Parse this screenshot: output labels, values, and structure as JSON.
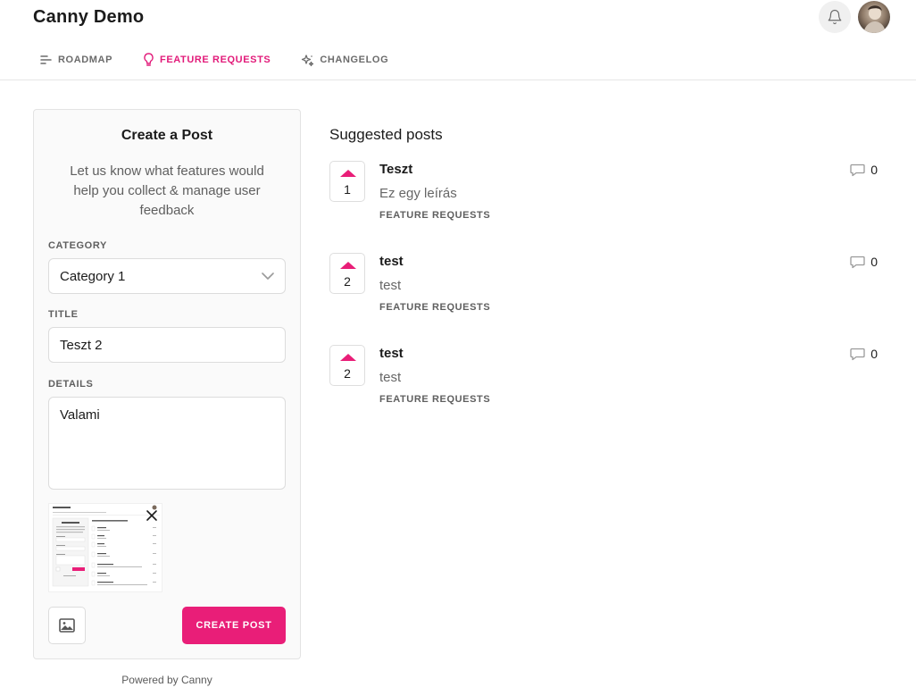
{
  "header": {
    "app_title": "Canny Demo"
  },
  "nav": {
    "items": [
      {
        "label": "ROADMAP",
        "icon": "roadmap-icon",
        "active": false
      },
      {
        "label": "FEATURE REQUESTS",
        "icon": "lightbulb-icon",
        "active": true
      },
      {
        "label": "CHANGELOG",
        "icon": "sparkle-icon",
        "active": false
      }
    ]
  },
  "create_post": {
    "title": "Create a Post",
    "description": "Let us know what features would help you collect & manage user feedback",
    "category": {
      "label": "CATEGORY",
      "value": "Category 1"
    },
    "title_field": {
      "label": "TITLE",
      "value": "Teszt 2"
    },
    "details": {
      "label": "DETAILS",
      "value": "Valami"
    },
    "submit_label": "CREATE POST"
  },
  "powered_by": "Powered by Canny",
  "suggested": {
    "heading": "Suggested posts",
    "posts": [
      {
        "votes": "1",
        "title": "Teszt",
        "description": "Ez egy leírás",
        "board": "FEATURE REQUESTS",
        "comments": "0"
      },
      {
        "votes": "2",
        "title": "test",
        "description": "test",
        "board": "FEATURE REQUESTS",
        "comments": "0"
      },
      {
        "votes": "2",
        "title": "test",
        "description": "test",
        "board": "FEATURE REQUESTS",
        "comments": "0"
      }
    ]
  },
  "colors": {
    "accent": "#e91e78",
    "text": "#1b1b1b",
    "muted": "#5f5f5f",
    "border": "#dcdcdc"
  }
}
